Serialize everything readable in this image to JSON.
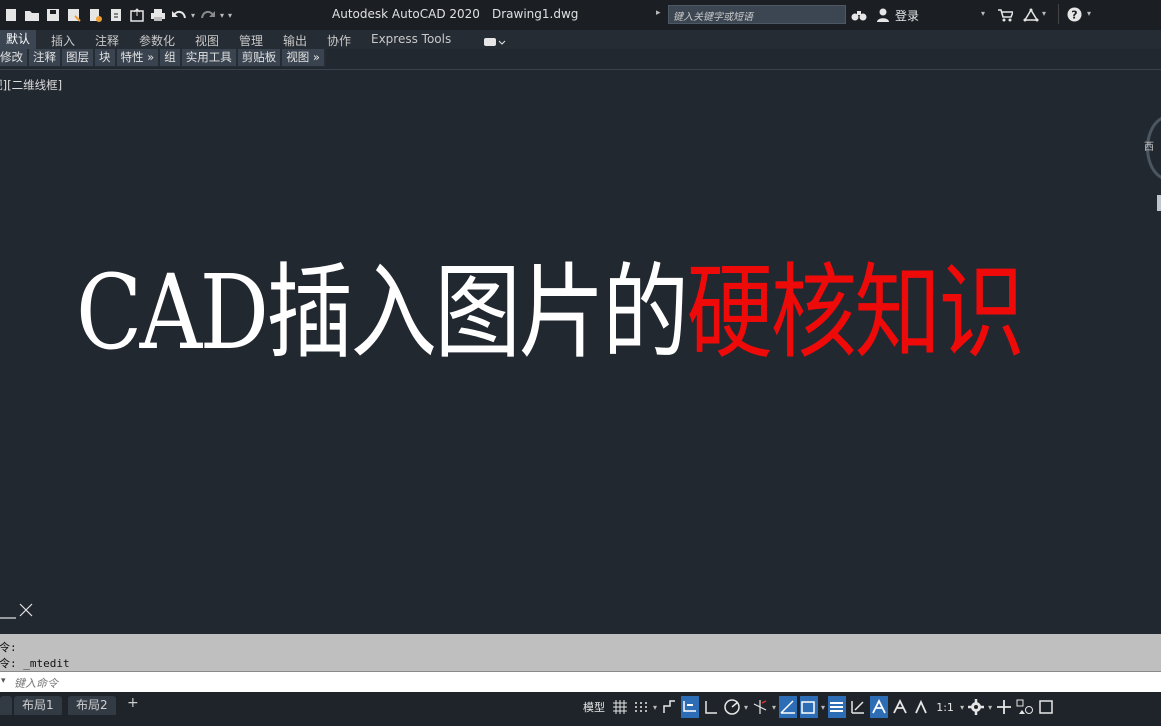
{
  "app": {
    "title": "Autodesk AutoCAD 2020",
    "document": "Drawing1.dwg"
  },
  "search": {
    "placeholder": "键入关键字或短语"
  },
  "user": {
    "login_label": "登录"
  },
  "ribbon_tabs": [
    "默认",
    "插入",
    "注释",
    "参数化",
    "视图",
    "管理",
    "输出",
    "协作",
    "Express Tools"
  ],
  "panels": [
    "修改",
    "注释",
    "图层",
    "块",
    "特性 »",
    "组",
    "实用工具",
    "剪贴板",
    "视图 »"
  ],
  "viewport": {
    "label": "[-][俯视][二维线框]",
    "headline_white": "CAD插入图片的",
    "headline_red": "硬核知识",
    "viewcube_label": "西"
  },
  "command": {
    "history": [
      "命令:",
      "命令: _mtedit"
    ],
    "placeholder": "键入命令"
  },
  "status": {
    "layout_tabs": [
      "布局1",
      "布局2"
    ],
    "model_label": "模型",
    "scale_label": "1:1"
  },
  "colors": {
    "background": "#212830",
    "accent_red": "#ef0a0a",
    "toggle_on": "#2c6db5"
  }
}
